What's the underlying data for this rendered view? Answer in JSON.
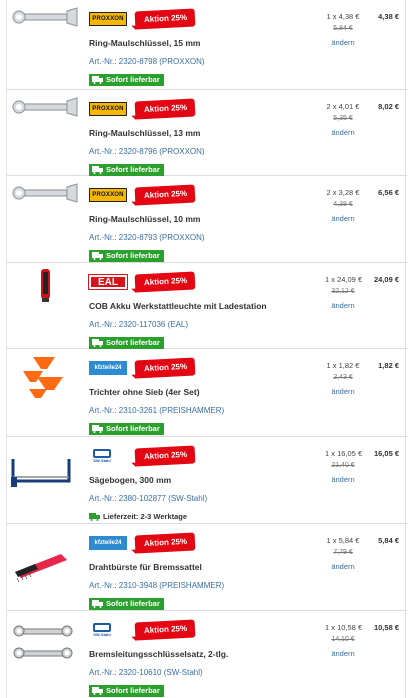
{
  "items": [
    {
      "product_icon": "open-end-ring-wrench",
      "brand": "PROXXON",
      "brand_logo": "proxxon",
      "badge": "Aktion 25%",
      "name": "Ring-Maulschlüssel, 15 mm",
      "artnr": "Art.-Nr.: 2320-8798 (PROXXON)",
      "availability": "Sofort lieferbar",
      "availability_type": "instock",
      "qty": "1 x 4,38 €",
      "old_price": "5,84 €",
      "change": "ändern",
      "total": "4,38 €"
    },
    {
      "product_icon": "open-end-ring-wrench",
      "brand": "PROXXON",
      "brand_logo": "proxxon",
      "badge": "Aktion 25%",
      "name": "Ring-Maulschlüssel, 13 mm",
      "artnr": "Art.-Nr.: 2320-8796 (PROXXON)",
      "availability": "Sofort lieferbar",
      "availability_type": "instock",
      "qty": "2 x 4,01 €",
      "old_price": "5,35 €",
      "change": "ändern",
      "total": "8,02 €"
    },
    {
      "product_icon": "open-end-ring-wrench",
      "brand": "PROXXON",
      "brand_logo": "proxxon",
      "badge": "Aktion 25%",
      "name": "Ring-Maulschlüssel, 10 mm",
      "artnr": "Art.-Nr.: 2320-8793 (PROXXON)",
      "availability": "Sofort lieferbar",
      "availability_type": "instock",
      "qty": "2 x 3,28 €",
      "old_price": "4,38 €",
      "change": "ändern",
      "total": "6,56 €"
    },
    {
      "product_icon": "work-lamp",
      "brand": "EAL",
      "brand_logo": "eal",
      "badge": "Aktion 25%",
      "name": "COB Akku Werkstattleuchte mit Ladestation",
      "artnr": "Art.-Nr.: 2320-117036 (EAL)",
      "availability": "Sofort lieferbar",
      "availability_type": "instock",
      "qty": "1 x 24,09 €",
      "old_price": "32,12 €",
      "change": "ändern",
      "total": "24,09 €"
    },
    {
      "product_icon": "funnel-set",
      "brand": "kfzteile24",
      "brand_logo": "kfz",
      "badge": "Aktion 25%",
      "name": "Trichter ohne Sieb (4er Set)",
      "artnr": "Art.-Nr.: 2310-3261 (PREISHAMMER)",
      "availability": "Sofort lieferbar",
      "availability_type": "instock",
      "qty": "1 x 1,82 €",
      "old_price": "2,43 €",
      "change": "ändern",
      "total": "1,82 €"
    },
    {
      "product_icon": "hacksaw",
      "brand": "SW-Stahl",
      "brand_logo": "sw",
      "badge": "Aktion 25%",
      "name": "Sägebogen, 300 mm",
      "artnr": "Art.-Nr.: 2380-102877 (SW-Stahl)",
      "availability": "Lieferzeit: 2-3 Werktage",
      "availability_type": "delay",
      "qty": "1 x 16,05 €",
      "old_price": "21,40 €",
      "change": "ändern",
      "total": "16,05 €"
    },
    {
      "product_icon": "wire-brush",
      "brand": "kfzteile24",
      "brand_logo": "kfz",
      "badge": "Aktion 25%",
      "name": "Drahtbürste für Bremssattel",
      "artnr": "Art.-Nr.: 2310-3948 (PREISHAMMER)",
      "availability": "Sofort lieferbar",
      "availability_type": "instock",
      "qty": "1 x 5,84 €",
      "old_price": "7,79 €",
      "change": "ändern",
      "total": "5,84 €"
    },
    {
      "product_icon": "brake-line-wrench-set",
      "brand": "SW-Stahl",
      "brand_logo": "sw",
      "badge": "Aktion 25%",
      "name": "Bremsleitungsschlüsselsatz, 2-tlg.",
      "artnr": "Art.-Nr.: 2320-10610 (SW-Stahl)",
      "availability": "Sofort lieferbar",
      "availability_type": "instock",
      "qty": "1 x 10,58 €",
      "old_price": "14,10 €",
      "change": "ändern",
      "total": "10,58 €"
    }
  ],
  "colors": {
    "badge": "#e30613",
    "instock": "#2ca02c",
    "link": "#3a6ea5",
    "proxxon": "#f5b800",
    "eal": "#d8141a",
    "kfz": "#2d8bd1",
    "sw": "#1e5aa8"
  }
}
